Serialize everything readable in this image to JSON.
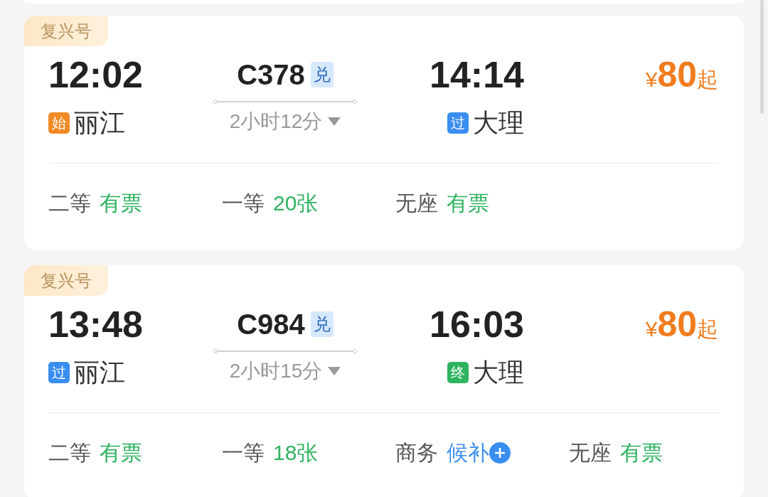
{
  "trains": [
    {
      "brand": "复兴号",
      "departure": {
        "time": "12:02",
        "tag": "始",
        "kind": "start",
        "station": "丽江"
      },
      "train_no": "C378",
      "exchange_badge": "兑",
      "duration": "2小时12分",
      "arrival": {
        "time": "14:14",
        "tag": "过",
        "kind": "pass",
        "station": "大理"
      },
      "price": {
        "currency": "¥",
        "amount": "80",
        "suffix": "起"
      },
      "seats": [
        {
          "class": "二等",
          "status": "有票",
          "kind": "available"
        },
        {
          "class": "一等",
          "status": "20张",
          "kind": "available"
        },
        {
          "class": "无座",
          "status": "有票",
          "kind": "available"
        }
      ]
    },
    {
      "brand": "复兴号",
      "departure": {
        "time": "13:48",
        "tag": "过",
        "kind": "pass",
        "station": "丽江"
      },
      "train_no": "C984",
      "exchange_badge": "兑",
      "duration": "2小时15分",
      "arrival": {
        "time": "16:03",
        "tag": "终",
        "kind": "end",
        "station": "大理"
      },
      "price": {
        "currency": "¥",
        "amount": "80",
        "suffix": "起"
      },
      "seats": [
        {
          "class": "二等",
          "status": "有票",
          "kind": "available"
        },
        {
          "class": "一等",
          "status": "18张",
          "kind": "available"
        },
        {
          "class": "商务",
          "status": "候补",
          "kind": "waitlist"
        },
        {
          "class": "无座",
          "status": "有票",
          "kind": "available"
        }
      ]
    }
  ]
}
